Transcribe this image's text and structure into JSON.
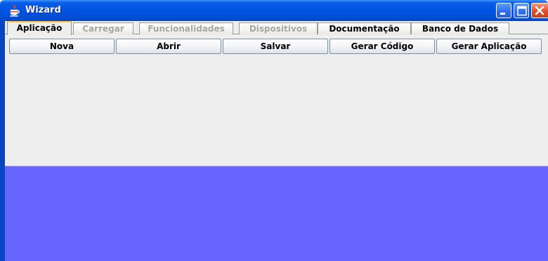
{
  "window": {
    "title": "Wizard",
    "icon": "java-cup-icon"
  },
  "title_buttons": [
    "minimize-icon",
    "maximize-icon",
    "close-icon"
  ],
  "tabs": [
    {
      "label": "Aplicação",
      "state": "selected"
    },
    {
      "label": "Carregar",
      "state": "disabled"
    },
    {
      "label": "Funcionalidades",
      "state": "disabled"
    },
    {
      "label": "Dispositivos",
      "state": "disabled"
    },
    {
      "label": "Documentação",
      "state": "enabled"
    },
    {
      "label": "Banco de Dados",
      "state": "enabled"
    }
  ],
  "toolbar": {
    "buttons": [
      {
        "label": "Nova"
      },
      {
        "label": "Abrir"
      },
      {
        "label": "Salvar"
      },
      {
        "label": "Gerar Código"
      },
      {
        "label": "Gerar Aplicação"
      }
    ]
  },
  "colors": {
    "titlebar": "#0054e3",
    "panel": "#eeeeee",
    "desktop_area": "#6666ff",
    "selected_tab_accent": "#ffc83c"
  }
}
